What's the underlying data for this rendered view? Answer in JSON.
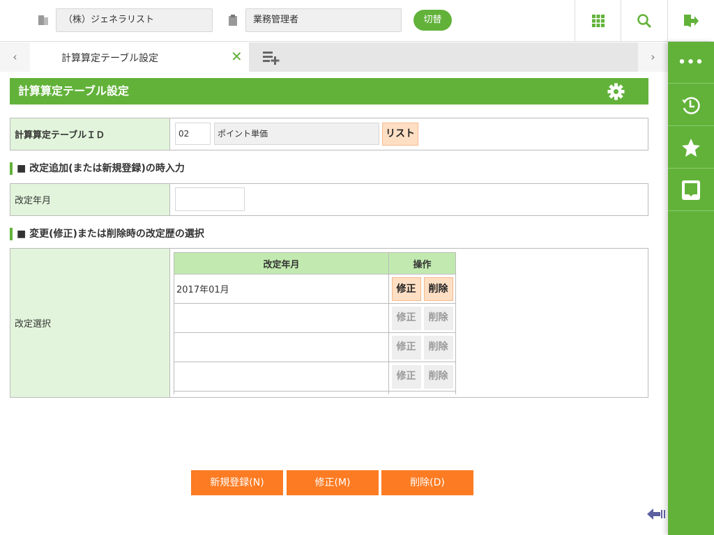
{
  "header": {
    "company": "（株）ジェネラリスト",
    "role": "業務管理者",
    "switch_label": "切替"
  },
  "tabs": {
    "active": "計算算定テーブル設定"
  },
  "page": {
    "title": "計算算定テーブル設定"
  },
  "form": {
    "table_id_label": "計算算定テーブルＩＤ",
    "table_id_value": "02",
    "table_name": "ポイント単価",
    "list_button": "リスト",
    "section1": "■ 改定追加(または新規登録)の時入力",
    "revision_label": "改定年月",
    "revision_value": "",
    "section2": "■ 変更(修正)または削除時の改定歴の選択",
    "select_label": "改定選択",
    "grid": {
      "col_date": "改定年月",
      "col_ops": "操作",
      "rows": [
        {
          "date": "2017年01月",
          "edit": "修正",
          "del": "削除",
          "enabled": true
        },
        {
          "date": "",
          "edit": "修正",
          "del": "削除",
          "enabled": false
        },
        {
          "date": "",
          "edit": "修正",
          "del": "削除",
          "enabled": false
        },
        {
          "date": "",
          "edit": "修正",
          "del": "削除",
          "enabled": false
        }
      ]
    }
  },
  "actions": {
    "new": "新規登録(N)",
    "edit": "修正(M)",
    "delete": "削除(D)"
  },
  "colors": {
    "green": "#62b23a",
    "orange": "#fd7b22",
    "label_bg": "#e2f5dc"
  }
}
